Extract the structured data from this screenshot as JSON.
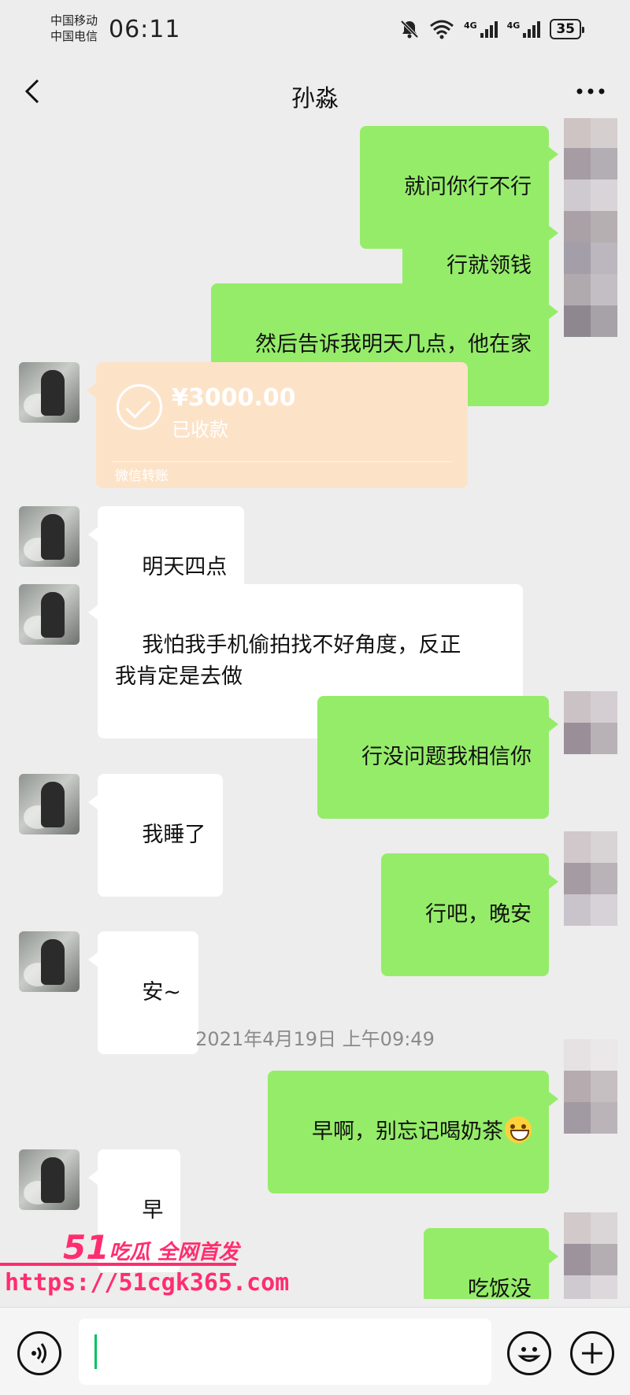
{
  "status_bar": {
    "carrier_1": "中国移动",
    "carrier_2": "中国电信",
    "time": "06:11",
    "signal_1_label": "4G",
    "signal_2_label": "4G",
    "battery": "35"
  },
  "header": {
    "title": "孙淼",
    "more_label": "···"
  },
  "messages": [
    {
      "type": "text",
      "direction": "out",
      "text": "就问你行不行"
    },
    {
      "type": "text",
      "direction": "out",
      "text": "行就领钱"
    },
    {
      "type": "text",
      "direction": "out",
      "text": "然后告诉我明天几点，他在家"
    },
    {
      "type": "transfer",
      "direction": "in",
      "amount": "¥3000.00",
      "status": "已收款",
      "source": "微信转账"
    },
    {
      "type": "text",
      "direction": "in",
      "text": "明天四点"
    },
    {
      "type": "text",
      "direction": "in",
      "text": "我怕我手机偷拍找不好角度，反正\n我肯定是去做"
    },
    {
      "type": "text",
      "direction": "out",
      "text": "行没问题我相信你"
    },
    {
      "type": "text",
      "direction": "in",
      "text": "我睡了"
    },
    {
      "type": "text",
      "direction": "out",
      "text": "行吧，晚安"
    },
    {
      "type": "text",
      "direction": "in",
      "text": "安~"
    },
    {
      "type": "timestamp",
      "text": "2021年4月19日 上午09:49"
    },
    {
      "type": "text",
      "direction": "out",
      "text": "早啊，别忘记喝奶茶",
      "emoji": "grinning-face"
    },
    {
      "type": "text",
      "direction": "in",
      "text": "早"
    },
    {
      "type": "text",
      "direction": "out",
      "text": "吃饭没"
    }
  ],
  "watermark": {
    "number": "51",
    "brand": "吃瓜 全网首发",
    "url": "https://51cgk365.com",
    "color": "#ff2d6f"
  },
  "input_bar": {
    "voice_icon": "voice-icon",
    "emoji_icon": "emoji-icon",
    "plus_icon": "plus-icon"
  },
  "colors": {
    "background": "#ededed",
    "outgoing_bubble": "#95ec69",
    "incoming_bubble": "#ffffff",
    "transfer_card": "#fce3c8",
    "accent": "#07c160"
  }
}
